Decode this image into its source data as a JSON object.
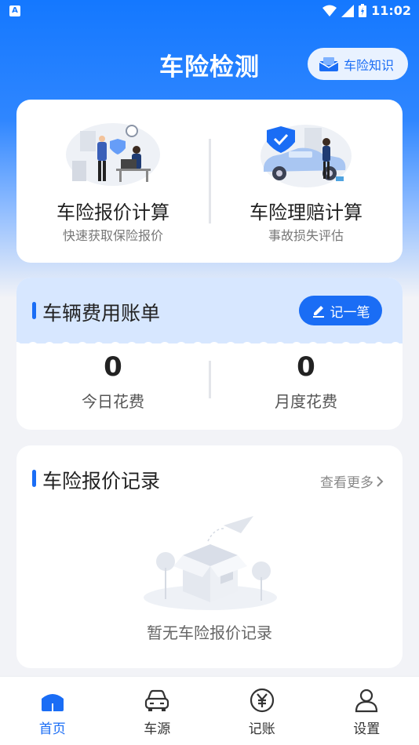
{
  "status_bar": {
    "time": "11:02",
    "notification_icon": "A"
  },
  "header": {
    "title": "车险检测",
    "knowledge_button": "车险知识"
  },
  "calculators": [
    {
      "title": "车险报价计算",
      "subtitle": "快速获取保险报价",
      "icon": "insurance-quote-illustration"
    },
    {
      "title": "车险理赔计算",
      "subtitle": "事故损失评估",
      "icon": "claim-car-illustration"
    }
  ],
  "bill": {
    "title": "车辆费用账单",
    "record_button": "记一笔",
    "today_value": "0",
    "today_label": "今日花费",
    "month_value": "0",
    "month_label": "月度花费"
  },
  "records": {
    "title": "车险报价记录",
    "more": "查看更多",
    "empty_text": "暂无车险报价记录"
  },
  "tabbar": [
    {
      "label": "首页",
      "icon": "home-icon",
      "active": true
    },
    {
      "label": "车源",
      "icon": "car-icon",
      "active": false
    },
    {
      "label": "记账",
      "icon": "yen-icon",
      "active": false
    },
    {
      "label": "设置",
      "icon": "user-icon",
      "active": false
    }
  ],
  "colors": {
    "primary": "#1a6df5",
    "header_blue": "#1478ff",
    "bill_head_bg": "#d7e7ff"
  }
}
